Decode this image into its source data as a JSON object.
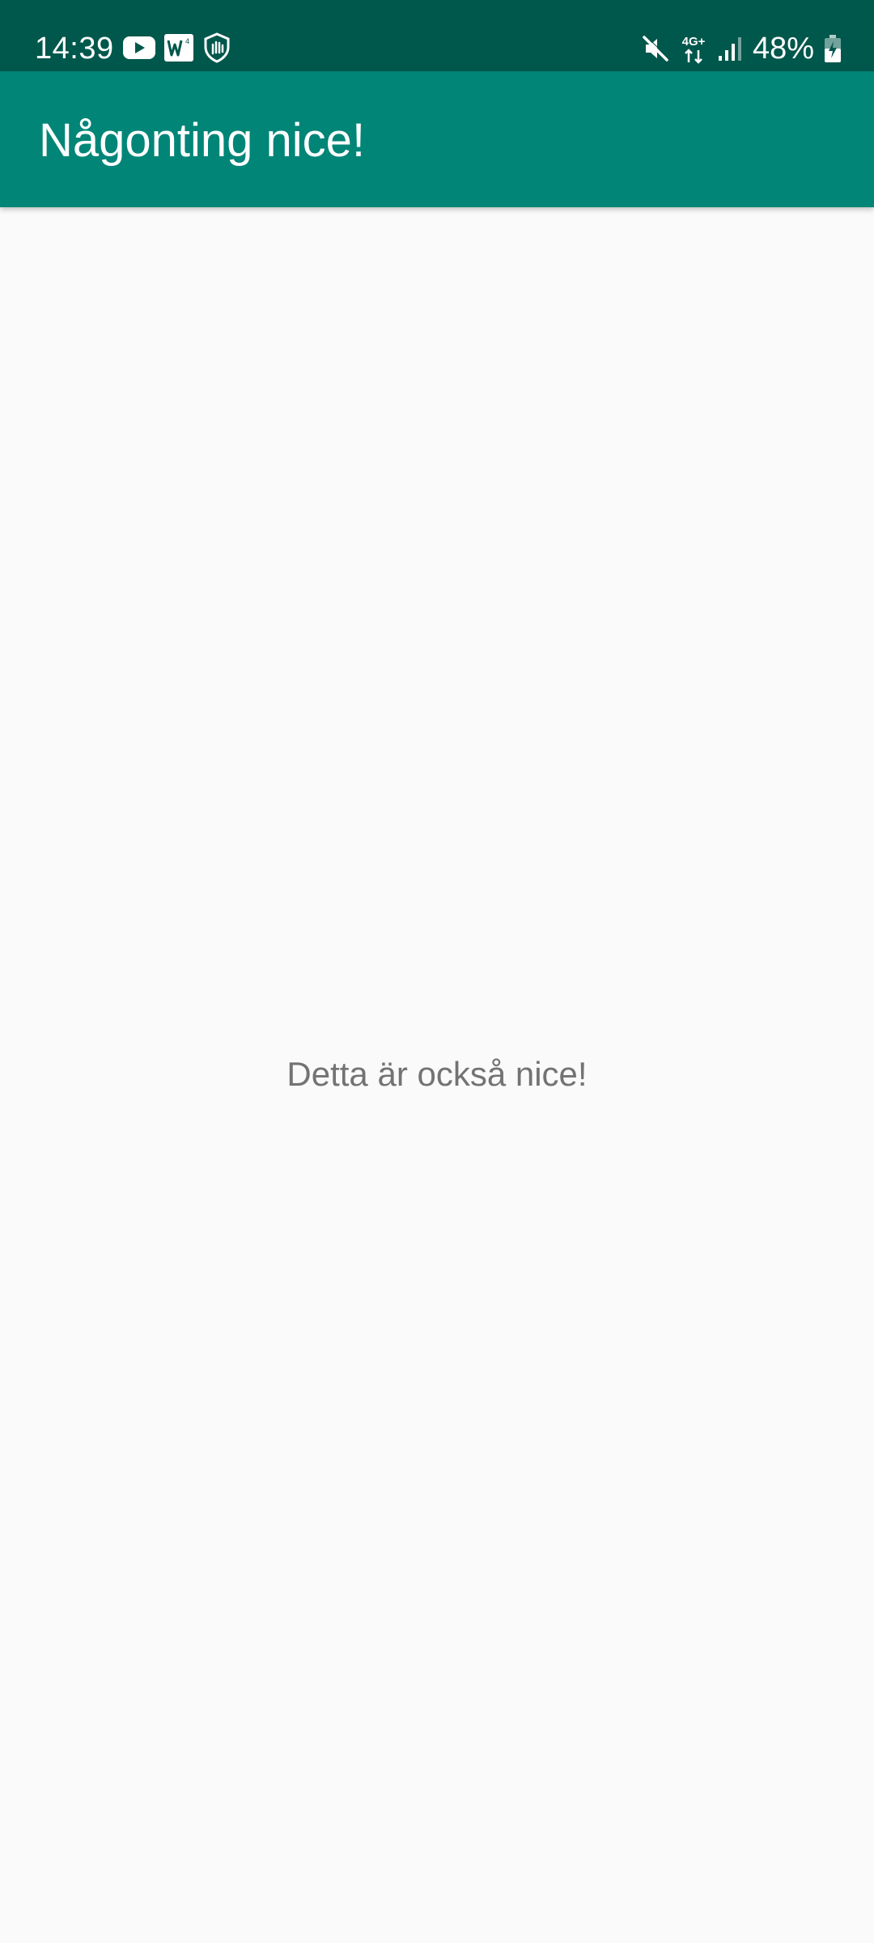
{
  "status_bar": {
    "time": "14:39",
    "battery_percent": "48%",
    "network_type": "4G+",
    "icons_left": [
      "youtube-icon",
      "w-app-icon",
      "shield-hand-icon"
    ],
    "icons_right": [
      "mute-icon",
      "network-4g-icon",
      "signal-icon",
      "battery-icon"
    ]
  },
  "app_bar": {
    "title": "Någonting nice!"
  },
  "content": {
    "message": "Detta är också nice!"
  },
  "colors": {
    "status_bar": "#00574b",
    "app_bar": "#008577",
    "background": "#fafafa",
    "text_secondary": "#737373"
  }
}
